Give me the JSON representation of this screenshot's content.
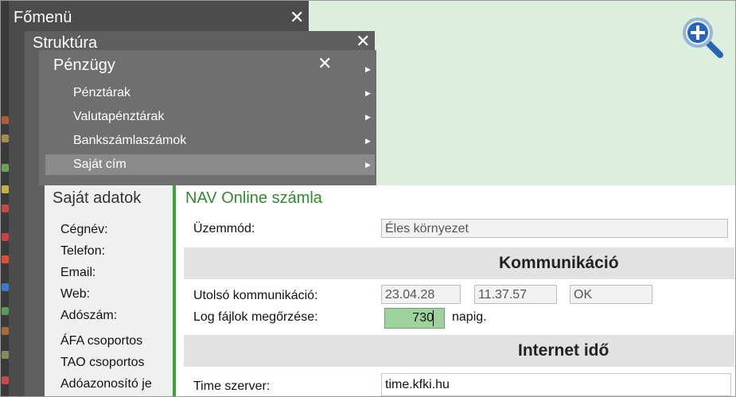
{
  "menus": {
    "main_title": "Főmenü",
    "struktura_title": "Struktúra",
    "penzugy_title": "Pénzügy",
    "close_glyph": "✕",
    "items": [
      {
        "label": "Pénztárak"
      },
      {
        "label": "Valutapénztárak"
      },
      {
        "label": "Bankszámlaszámok"
      },
      {
        "label": "Saját cím",
        "selected": true
      }
    ]
  },
  "own_data": {
    "title": "Saját adatok",
    "fields": [
      "Cégnév:",
      "Telefon:",
      "Email:",
      "Web:",
      "Adószám:",
      "ÁFA csoportos",
      "TAO csoportos",
      "Adóazonosító je"
    ]
  },
  "nav": {
    "title": "NAV Online számla",
    "mode_label": "Üzemmód:",
    "mode_value": "Éles környezet",
    "section_comm": "Kommunikáció",
    "last_comm_label": "Utolsó kommunikáció:",
    "last_comm_date": "23.04.28",
    "last_comm_time": "11.37.57",
    "last_comm_status": "OK",
    "log_label": "Log fájlok megőrzése:",
    "log_value": "730",
    "log_unit": "napig.",
    "section_time": "Internet idő",
    "time_server_label": "Time szerver:",
    "time_server_value": "time.kfki.hu"
  },
  "colors": {
    "accent_green": "#3aa53a",
    "title_green": "#2e8b2e",
    "background_green": "#dcefdc"
  }
}
